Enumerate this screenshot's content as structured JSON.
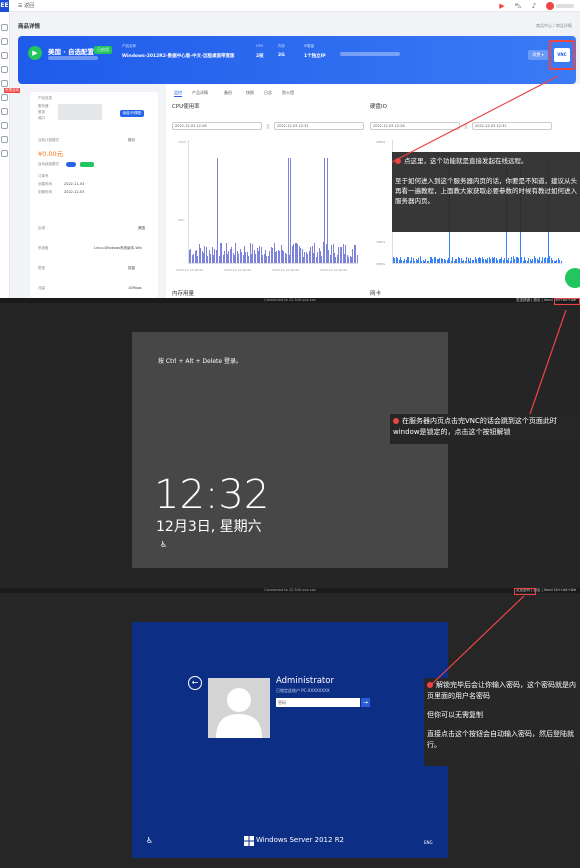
{
  "topbar": {
    "logo": "EE",
    "back_label": "☰ 返回"
  },
  "page": {
    "title": "商品详情",
    "breadcrumb": "商品中心 / 商品详情"
  },
  "banner": {
    "name": "美国 · 自选配置",
    "tag": "已启用",
    "columns": [
      {
        "label": "产品名称",
        "value": "Windows-2012R2-数据中心版-中文-远程桌面带宽版"
      },
      {
        "label": "CPU",
        "value": "2核"
      },
      {
        "label": "内存",
        "value": "2G"
      },
      {
        "label": "IP数量",
        "value": "1个独立IP"
      }
    ],
    "btn1": "续费 ▾",
    "btn2": "VNC"
  },
  "left_card": {
    "section_title": "产品信息",
    "labels": [
      "服务器",
      "登录",
      "端口",
      "当前计费模式",
      "自动续费模式",
      "订单号",
      "创建时间",
      "到期时间",
      "区域",
      "系统盘",
      "带宽",
      "流量"
    ],
    "price": "¥0.00元",
    "renew_btn": "续费/升降配",
    "values": [
      "按月",
      "2022-11-03",
      "2022-12-03",
      "美国",
      "Linux-Windows系统版本-Win",
      "按量",
      "10Mbps",
      "不限"
    ],
    "badge": "优惠活动"
  },
  "tabs": [
    "监控",
    "产品详情",
    "备份",
    "快照",
    "日志",
    "防火墙"
  ],
  "cpu": {
    "title": "CPU使用率",
    "date1": "2022-12-03 12:26",
    "sep": "至",
    "date2": "2022-12-03 12:32",
    "yticks": [
      "100%",
      "80%",
      "60%",
      "40%",
      "20%",
      "0%"
    ],
    "xticks": [
      "2022-11-15 08:00",
      "2022-11-22 08:00",
      "2022-11-29 08:00",
      "2022-12-01 08:00"
    ]
  },
  "disk": {
    "title": "硬盘IO",
    "date1": "2022-12-03 12:26",
    "sep": "至",
    "date2": "2022-12-03 12:32",
    "yticks": [
      "5MB/s",
      "4MB/s",
      "3MB/s",
      "2MB/s",
      "1MB/s",
      "0MB/s"
    ]
  },
  "bottom": {
    "mem": "内存用量",
    "net": "网卡"
  },
  "ann1": {
    "l1": "点这里，这个功能就是直接发起在线远程。",
    "l2": "至于如何进入到这个服务器内页的话，你要是不知道，建议从头再看一遍教程，上面教大家获取必要参数的时候有教过如何进入服务器内页。"
  },
  "vnc1": {
    "bar": "Connected to 12.345.xxx.xxx",
    "right": "发送按键 | 退出 | Send Ctrl+Alt+Del"
  },
  "lock": {
    "hint": "按 Ctrl + Alt + Delete 登录。",
    "time": "12:32",
    "date": "12月3日, 星期六",
    "icon": "♿"
  },
  "ann2": {
    "text": "在服务器内页点击完VNC的话会跳到这个页面此时window是锁定的，点击这个按钮解锁"
  },
  "vnc2": {
    "bar": "Connected to 12.345.xxx.xxx",
    "right": "发送密码 | 退出 | Send Ctrl+Alt+Del"
  },
  "login": {
    "user": "Administrator",
    "sub": "已锁定此账户 PC-XXXXXXXX",
    "placeholder": "密码",
    "go": "→",
    "os": "Windows Server 2012 R2",
    "lang": "ENG",
    "ease": "♿",
    "back": "←"
  },
  "ann3": {
    "l1": "解锁完毕后会让你输入密码，这个密码就是内页里面的用户名密码",
    "l2": "但你可以无需复制",
    "l3": "直接点击这个按钮会自动输入密码，然后登陆就行。"
  },
  "colors": {
    "accent": "#2563eb",
    "annotation_red": "#ef4444",
    "login_bg": "#0c2e84",
    "lock_bg": "#474747"
  }
}
